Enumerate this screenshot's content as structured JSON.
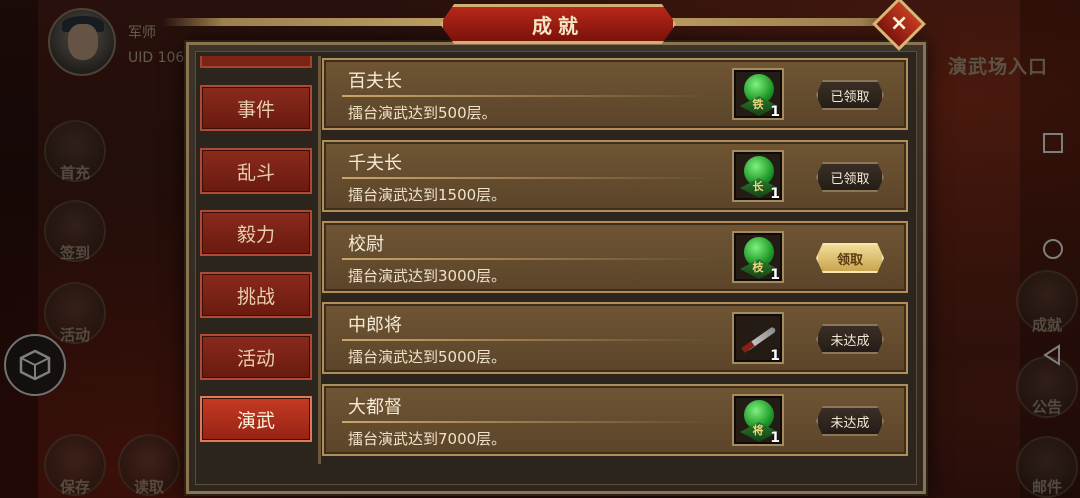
{
  "player": {
    "title": "军师",
    "uid": "UID  106"
  },
  "entrance_label": "演武场入口",
  "left_menu": [
    {
      "label": "首充"
    },
    {
      "label": "签到"
    },
    {
      "label": "活动"
    },
    {
      "label": "保存"
    },
    {
      "label": "读取"
    }
  ],
  "right_menu": [
    {
      "label": "成就"
    },
    {
      "label": "公告"
    },
    {
      "label": "邮件"
    }
  ],
  "modal": {
    "title": "成就",
    "close_label": "×",
    "tabs": [
      {
        "label": "事件",
        "active": false
      },
      {
        "label": "乱斗",
        "active": false
      },
      {
        "label": "毅力",
        "active": false
      },
      {
        "label": "挑战",
        "active": false
      },
      {
        "label": "活动",
        "active": false
      },
      {
        "label": "演武",
        "active": true
      }
    ],
    "achievements": [
      {
        "title": "百夫长",
        "desc": "擂台演武达到500层。",
        "reward_icon": "green-jade-seal-icon",
        "reward_glyph": "铁",
        "qty": "1",
        "status": "已领取"
      },
      {
        "title": "千夫长",
        "desc": "擂台演武达到1500层。",
        "reward_icon": "green-jade-seal-icon",
        "reward_glyph": "长",
        "qty": "1",
        "status": "已领取"
      },
      {
        "title": "校尉",
        "desc": "擂台演武达到3000层。",
        "reward_icon": "green-jade-seal-icon",
        "reward_glyph": "枝",
        "qty": "1",
        "status": "领取"
      },
      {
        "title": "中郎将",
        "desc": "擂台演武达到5000层。",
        "reward_icon": "sword-icon",
        "reward_glyph": "",
        "qty": "1",
        "status": "未达成"
      },
      {
        "title": "大都督",
        "desc": "擂台演武达到7000层。",
        "reward_icon": "green-jade-seal-icon",
        "reward_glyph": "将",
        "qty": "1",
        "status": "未达成"
      }
    ]
  },
  "colors": {
    "accent_red": "#b8281a",
    "gold": "#c9a66a",
    "claim_gold": "#e8cf84"
  }
}
